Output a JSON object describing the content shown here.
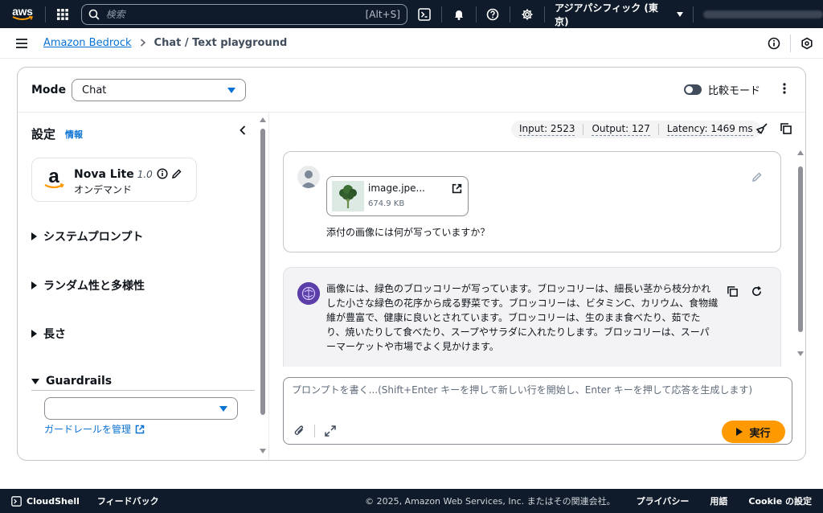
{
  "topnav": {
    "logo": "aws",
    "search_placeholder": "検索",
    "search_shortcut": "[Alt+S]",
    "region": "アジアパシフィック (東京)",
    "icons": [
      "grid-icon",
      "search-icon",
      "terminal-icon",
      "bell-icon",
      "help-icon",
      "gear-icon"
    ]
  },
  "breadcrumb": {
    "root": "Amazon Bedrock",
    "current": "Chat / Text playground"
  },
  "mode": {
    "label": "Mode",
    "selected": "Chat",
    "compare_label": "比較モード"
  },
  "settings": {
    "title": "設定",
    "info": "情報",
    "model": {
      "name": "Nova Lite",
      "version": "1.0",
      "subtitle": "オンデマンド"
    },
    "sections": [
      "システムプロンプト",
      "ランダム性と多様性",
      "長さ",
      "Guardrails"
    ],
    "guardrails_manage": "ガードレールを管理"
  },
  "metrics": {
    "input": "Input: 2523",
    "output": "Output: 127",
    "latency": "Latency: 1469 ms"
  },
  "user_message": {
    "file_name": "image.jpe...",
    "file_size": "674.9 KB",
    "text": "添付の画像には何が写っていますか？"
  },
  "ai_message": {
    "text": "画像には、緑色のブロッコリーが写っています。ブロッコリーは、細長い茎から枝分かれした小さな緑色の花序から成る野菜です。ブロッコリーは、ビタミンC、カリウム、食物繊維が豊富で、健康に良いとされています。ブロッコリーは、生のまま食べたり、茹でたり、焼いたりして食べたり、スープやサラダに入れたりします。ブロッコリーは、スーパーマーケットや市場でよく見かけます。"
  },
  "prompt": {
    "placeholder": "プロンプトを書く...(Shift+Enter キーを押して新しい行を開始し、Enter キーを押して応答を生成します)",
    "run_label": "実行"
  },
  "footer": {
    "cloudshell": "CloudShell",
    "feedback": "フィードバック",
    "copyright": "© 2025, Amazon Web Services, Inc. またはその関連会社。",
    "privacy": "プライバシー",
    "terms": "用語",
    "cookie": "Cookie の設定"
  },
  "colors": {
    "nav_bg": "#0f1b2a",
    "link": "#0972d3",
    "run_button": "#ff9900"
  }
}
